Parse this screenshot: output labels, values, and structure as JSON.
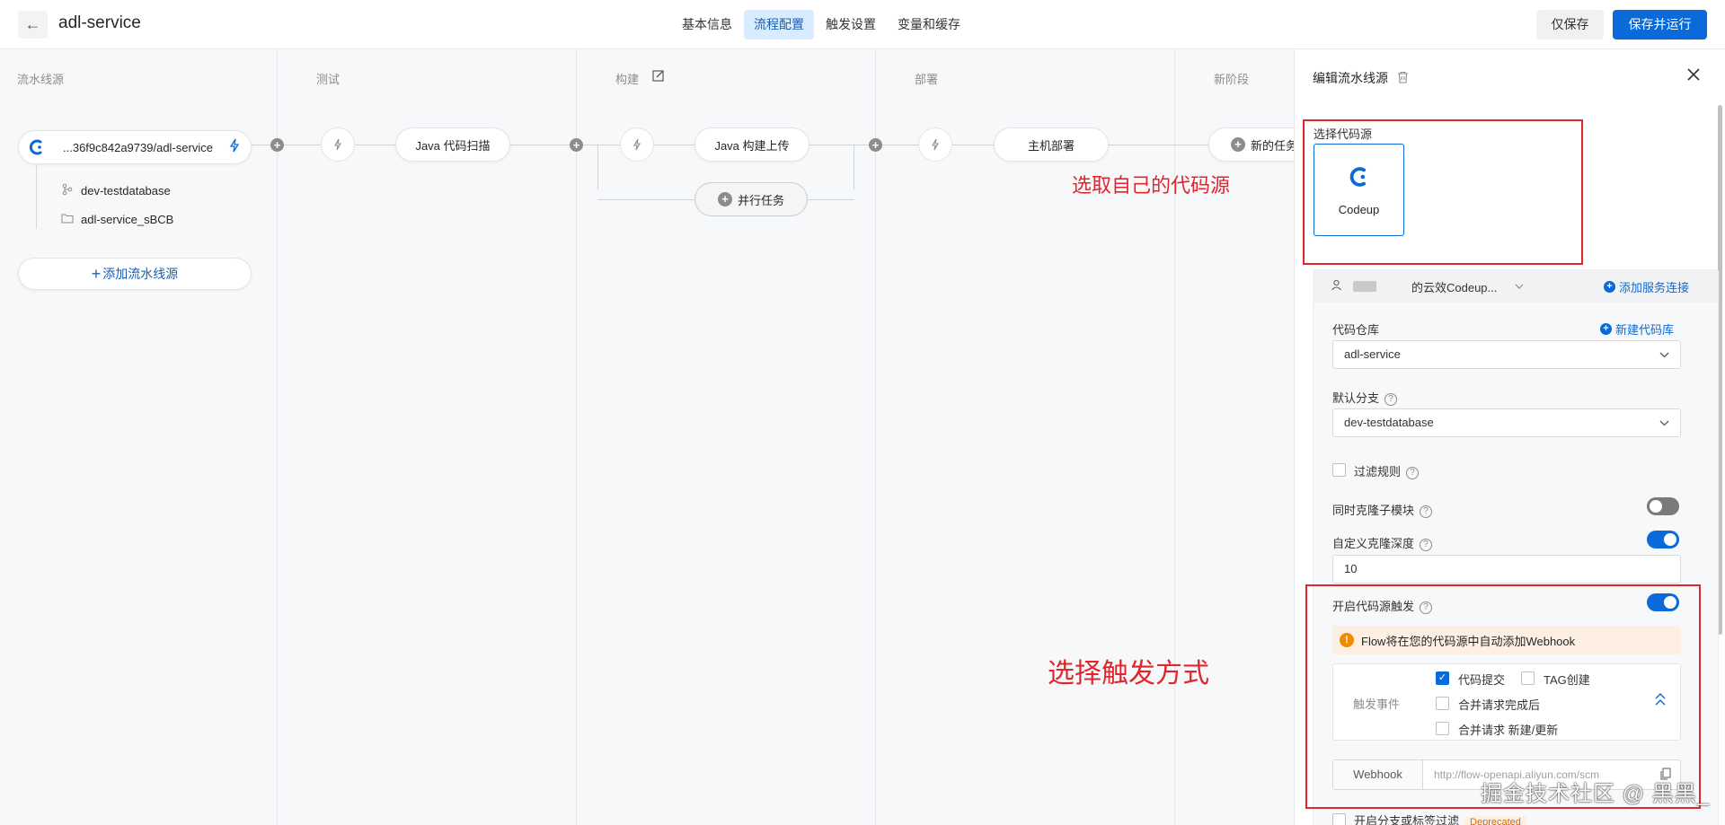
{
  "header": {
    "back_label": "←",
    "title": "adl-service",
    "tabs": [
      {
        "label": "基本信息"
      },
      {
        "label": "流程配置"
      },
      {
        "label": "触发设置"
      },
      {
        "label": "变量和缓存"
      }
    ],
    "active_tab": "流程配置",
    "save_only_label": "仅保存",
    "save_run_label": "保存并运行"
  },
  "pipeline": {
    "stages": [
      {
        "title": "流水线源"
      },
      {
        "title": "测试"
      },
      {
        "title": "构建"
      },
      {
        "title": "部署"
      },
      {
        "title": "新阶段"
      }
    ],
    "source": {
      "name": "...36f9c842a9739/adl-service",
      "branch": "dev-testdatabase",
      "folder": "adl-service_sBCB",
      "add_label": "添加流水线源"
    },
    "tasks": {
      "test_task": "Java 代码扫描",
      "build_task": "Java 构建上传",
      "parallel_label": "并行任务",
      "deploy_task": "主机部署",
      "new_task": "新的任务"
    },
    "annotations": {
      "choose_source": "选取自己的代码源",
      "choose_trigger": "选择触发方式"
    }
  },
  "panel": {
    "title": "编辑流水线源",
    "select_source_label": "选择代码源",
    "source_card_name": "Codeup",
    "connection": {
      "name": "的云效Codeup...",
      "add_label": "添加服务连接"
    },
    "repo": {
      "label": "代码仓库",
      "new_label": "新建代码库",
      "value": "adl-service"
    },
    "branch": {
      "label": "默认分支",
      "value": "dev-testdatabase"
    },
    "filter_rule_label": "过滤规则",
    "clone_submodules_label": "同时克隆子模块",
    "clone_submodules_on": false,
    "clone_depth_label": "自定义克隆深度",
    "clone_depth_on": true,
    "clone_depth_value": "10",
    "source_trigger_label": "开启代码源触发",
    "source_trigger_on": true,
    "webhook_warning": "Flow将在您的代码源中自动添加Webhook",
    "events": {
      "label": "触发事件",
      "items": [
        {
          "label": "代码提交",
          "checked": true
        },
        {
          "label": "TAG创建",
          "checked": false
        },
        {
          "label": "合并请求完成后",
          "checked": false
        },
        {
          "label": "合并请求 新建/更新",
          "checked": false
        }
      ]
    },
    "webhook": {
      "label": "Webhook",
      "url": "http://flow-openapi.aliyun.com/scm"
    },
    "branch_filter_label": "开启分支或标签过滤",
    "deprecated_badge": "Deprecated"
  },
  "watermark": "掘金技术社区 @ 黑黑_",
  "colors": {
    "accent": "#0a6ad9",
    "annotation_red": "#e0262d",
    "warning": "#f08c00"
  }
}
